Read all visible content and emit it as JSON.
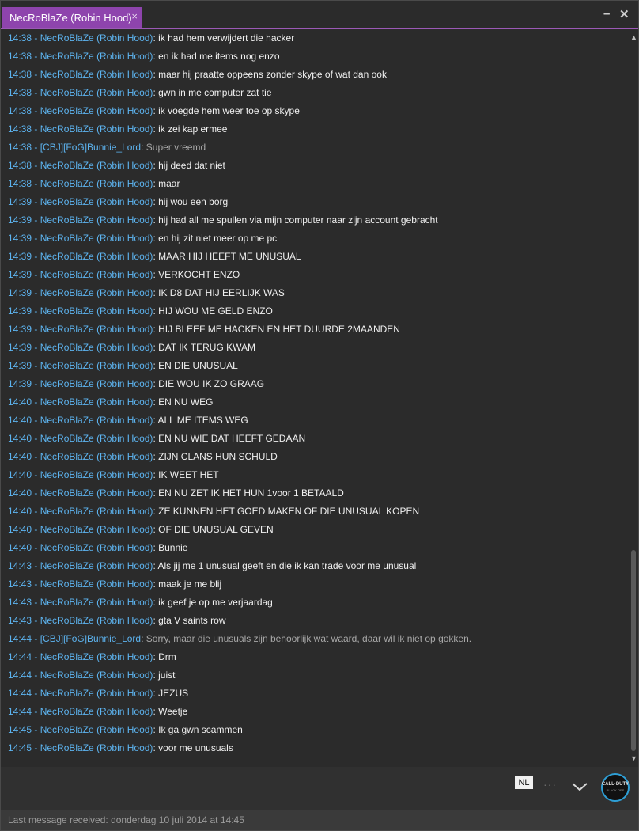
{
  "window": {
    "tab_title": "NecRoBlaZe (Robin Hood)",
    "tab_close": "×",
    "minimize": "–",
    "close": "✕"
  },
  "messages": [
    {
      "time": "14:38",
      "sender": "NecRoBlaZe (Robin Hood)",
      "text": "ik had hem verwijdert die hacker"
    },
    {
      "time": "14:38",
      "sender": "NecRoBlaZe (Robin Hood)",
      "text": "en ik had me items nog enzo"
    },
    {
      "time": "14:38",
      "sender": "NecRoBlaZe (Robin Hood)",
      "text": "maar hij praatte oppeens zonder skype of wat dan ook"
    },
    {
      "time": "14:38",
      "sender": "NecRoBlaZe (Robin Hood)",
      "text": "gwn in me computer zat tie"
    },
    {
      "time": "14:38",
      "sender": "NecRoBlaZe (Robin Hood)",
      "text": "ik voegde hem weer toe op skype"
    },
    {
      "time": "14:38",
      "sender": "NecRoBlaZe (Robin Hood)",
      "text": "ik zei kap ermee"
    },
    {
      "time": "14:38",
      "sender": "[CBJ][FoG]Bunnie_Lord",
      "text": "Super vreemd",
      "other": true
    },
    {
      "time": "14:38",
      "sender": "NecRoBlaZe (Robin Hood)",
      "text": "hij deed dat niet"
    },
    {
      "time": "14:38",
      "sender": "NecRoBlaZe (Robin Hood)",
      "text": "maar"
    },
    {
      "time": "14:39",
      "sender": "NecRoBlaZe (Robin Hood)",
      "text": "hij wou een borg"
    },
    {
      "time": "14:39",
      "sender": "NecRoBlaZe (Robin Hood)",
      "text": "hij had all me spullen via mijn computer naar zijn account gebracht"
    },
    {
      "time": "14:39",
      "sender": "NecRoBlaZe (Robin Hood)",
      "text": "en hij zit niet meer op me pc"
    },
    {
      "time": "14:39",
      "sender": "NecRoBlaZe (Robin Hood)",
      "text": "MAAR HIJ HEEFT ME UNUSUAL"
    },
    {
      "time": "14:39",
      "sender": "NecRoBlaZe (Robin Hood)",
      "text": "VERKOCHT ENZO"
    },
    {
      "time": "14:39",
      "sender": "NecRoBlaZe (Robin Hood)",
      "text": "IK D8 DAT HIJ EERLIJK WAS"
    },
    {
      "time": "14:39",
      "sender": "NecRoBlaZe (Robin Hood)",
      "text": "HIJ WOU ME GELD ENZO"
    },
    {
      "time": "14:39",
      "sender": "NecRoBlaZe (Robin Hood)",
      "text": "HIJ BLEEF ME HACKEN EN HET DUURDE 2MAANDEN"
    },
    {
      "time": "14:39",
      "sender": "NecRoBlaZe (Robin Hood)",
      "text": "DAT IK TERUG KWAM"
    },
    {
      "time": "14:39",
      "sender": "NecRoBlaZe (Robin Hood)",
      "text": "EN DIE UNUSUAL"
    },
    {
      "time": "14:39",
      "sender": "NecRoBlaZe (Robin Hood)",
      "text": "DIE WOU IK ZO GRAAG"
    },
    {
      "time": "14:40",
      "sender": "NecRoBlaZe (Robin Hood)",
      "text": "EN NU WEG"
    },
    {
      "time": "14:40",
      "sender": "NecRoBlaZe (Robin Hood)",
      "text": "ALL ME ITEMS WEG"
    },
    {
      "time": "14:40",
      "sender": "NecRoBlaZe (Robin Hood)",
      "text": "EN NU WIE DAT HEEFT GEDAAN"
    },
    {
      "time": "14:40",
      "sender": "NecRoBlaZe (Robin Hood)",
      "text": "ZIJN CLANS HUN SCHULD"
    },
    {
      "time": "14:40",
      "sender": "NecRoBlaZe (Robin Hood)",
      "text": "IK WEET HET"
    },
    {
      "time": "14:40",
      "sender": "NecRoBlaZe (Robin Hood)",
      "text": "EN NU ZET IK HET HUN 1voor 1 BETAALD"
    },
    {
      "time": "14:40",
      "sender": "NecRoBlaZe (Robin Hood)",
      "text": "ZE KUNNEN HET GOED MAKEN OF DIE UNUSUAL KOPEN"
    },
    {
      "time": "14:40",
      "sender": "NecRoBlaZe (Robin Hood)",
      "text": "OF  DIE UNUSUAL GEVEN"
    },
    {
      "time": "14:40",
      "sender": "NecRoBlaZe (Robin Hood)",
      "text": "Bunnie"
    },
    {
      "time": "14:43",
      "sender": "NecRoBlaZe (Robin Hood)",
      "text": "Als jij me 1 unusual geeft en die ik kan trade voor me unusual"
    },
    {
      "time": "14:43",
      "sender": "NecRoBlaZe (Robin Hood)",
      "text": "maak je me blij"
    },
    {
      "time": "14:43",
      "sender": "NecRoBlaZe (Robin Hood)",
      "text": "ik geef je op me verjaardag"
    },
    {
      "time": "14:43",
      "sender": "NecRoBlaZe (Robin Hood)",
      "text": "gta V saints row"
    },
    {
      "time": "14:44",
      "sender": "[CBJ][FoG]Bunnie_Lord",
      "text": "Sorry, maar die unusuals zijn behoorlijk wat waard, daar wil ik niet op gokken.",
      "other": true
    },
    {
      "time": "14:44",
      "sender": "NecRoBlaZe (Robin Hood)",
      "text": "Drm"
    },
    {
      "time": "14:44",
      "sender": "NecRoBlaZe (Robin Hood)",
      "text": "juist"
    },
    {
      "time": "14:44",
      "sender": "NecRoBlaZe (Robin Hood)",
      "text": "JEZUS"
    },
    {
      "time": "14:44",
      "sender": "NecRoBlaZe (Robin Hood)",
      "text": "Weetje"
    },
    {
      "time": "14:45",
      "sender": "NecRoBlaZe (Robin Hood)",
      "text": "Ik ga gwn scammen"
    },
    {
      "time": "14:45",
      "sender": "NecRoBlaZe (Robin Hood)",
      "text": "voor me unusuals"
    }
  ],
  "composer": {
    "language": "NL",
    "more": "···",
    "avatar_line1": "CALL·DUTY",
    "avatar_line2": "BLACK OPS"
  },
  "status": {
    "text": "Last message received: donderdag 10 juli 2014 at 14:45"
  },
  "icons": {
    "close": "close-icon",
    "minimize": "minimize-icon",
    "chevron": "chevron-down-icon",
    "avatar": "avatar"
  },
  "colors": {
    "accent": "#8e44ad",
    "name": "#5db4f0",
    "text": "#f0f0f0",
    "other_text": "#a8a8a8",
    "background": "#2b2b2b"
  }
}
